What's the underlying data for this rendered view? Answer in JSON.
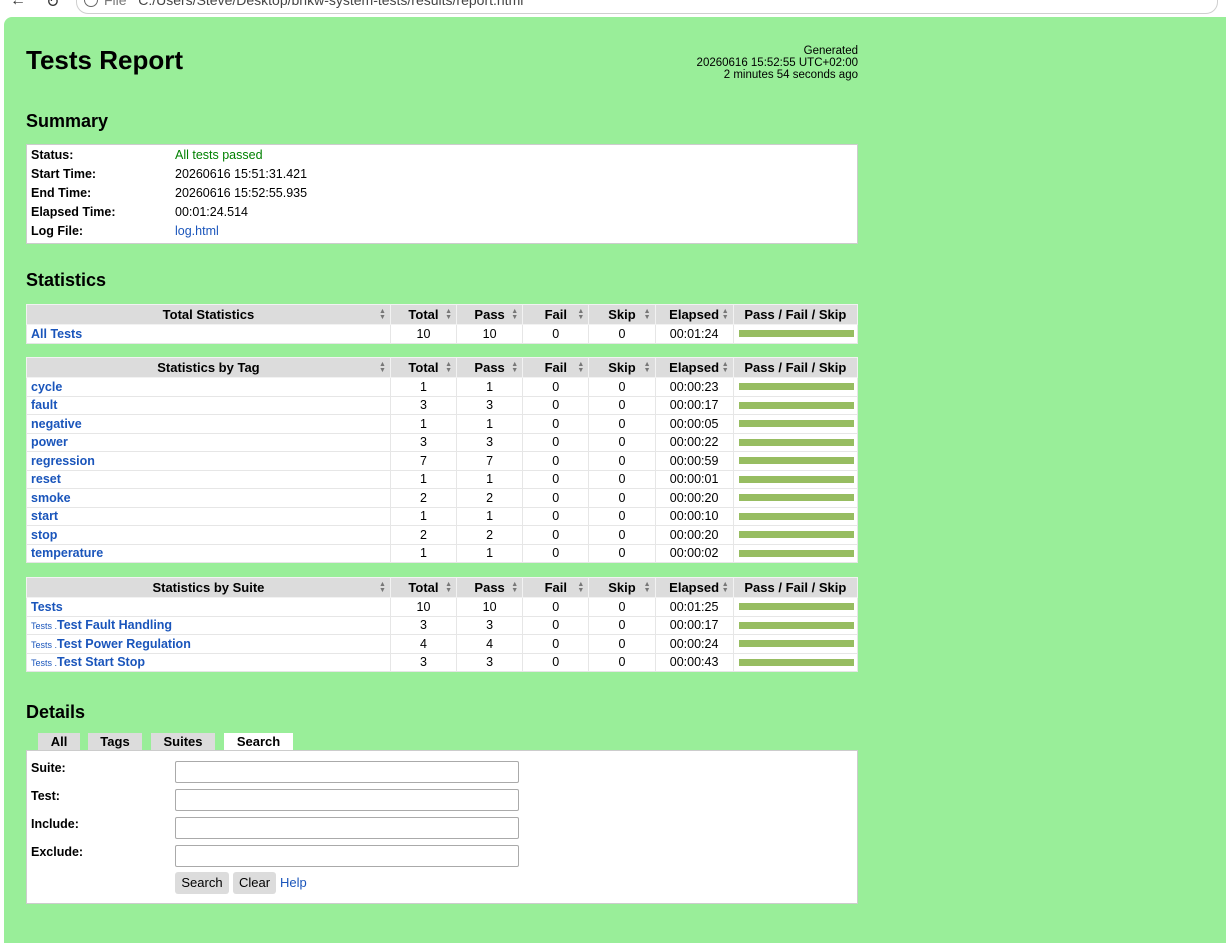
{
  "browser": {
    "url_scheme": "File",
    "url": "C:/Users/Steve/Desktop/bnkw-system-tests/results/report.html"
  },
  "header": {
    "title": "Tests Report",
    "generated_label": "Generated",
    "generated_time": "20260616 15:52:55 UTC+02:00",
    "generated_ago": "2 minutes 54 seconds ago"
  },
  "summary": {
    "heading": "Summary",
    "rows": [
      {
        "key": "Status:",
        "value": "All tests passed"
      },
      {
        "key": "Start Time:",
        "value": "20260616 15:51:31.421"
      },
      {
        "key": "End Time:",
        "value": "20260616 15:52:55.935"
      },
      {
        "key": "Elapsed Time:",
        "value": "00:01:24.514"
      },
      {
        "key": "Log File:",
        "value": "log.html"
      }
    ]
  },
  "statistics": {
    "heading": "Statistics",
    "columns": [
      "Total",
      "Pass",
      "Fail",
      "Skip",
      "Elapsed",
      "Pass / Fail / Skip"
    ],
    "total": {
      "title": "Total Statistics",
      "rows": [
        {
          "name": "All Tests",
          "total": "10",
          "pass": "10",
          "fail": "0",
          "skip": "0",
          "elapsed": "00:01:24",
          "pass_fraction": 1.0
        }
      ]
    },
    "by_tag": {
      "title": "Statistics by Tag",
      "rows": [
        {
          "name": "cycle",
          "total": "1",
          "pass": "1",
          "fail": "0",
          "skip": "0",
          "elapsed": "00:00:23",
          "pass_fraction": 1.0
        },
        {
          "name": "fault",
          "total": "3",
          "pass": "3",
          "fail": "0",
          "skip": "0",
          "elapsed": "00:00:17",
          "pass_fraction": 1.0
        },
        {
          "name": "negative",
          "total": "1",
          "pass": "1",
          "fail": "0",
          "skip": "0",
          "elapsed": "00:00:05",
          "pass_fraction": 1.0
        },
        {
          "name": "power",
          "total": "3",
          "pass": "3",
          "fail": "0",
          "skip": "0",
          "elapsed": "00:00:22",
          "pass_fraction": 1.0
        },
        {
          "name": "regression",
          "total": "7",
          "pass": "7",
          "fail": "0",
          "skip": "0",
          "elapsed": "00:00:59",
          "pass_fraction": 1.0
        },
        {
          "name": "reset",
          "total": "1",
          "pass": "1",
          "fail": "0",
          "skip": "0",
          "elapsed": "00:00:01",
          "pass_fraction": 1.0
        },
        {
          "name": "smoke",
          "total": "2",
          "pass": "2",
          "fail": "0",
          "skip": "0",
          "elapsed": "00:00:20",
          "pass_fraction": 1.0
        },
        {
          "name": "start",
          "total": "1",
          "pass": "1",
          "fail": "0",
          "skip": "0",
          "elapsed": "00:00:10",
          "pass_fraction": 1.0
        },
        {
          "name": "stop",
          "total": "2",
          "pass": "2",
          "fail": "0",
          "skip": "0",
          "elapsed": "00:00:20",
          "pass_fraction": 1.0
        },
        {
          "name": "temperature",
          "total": "1",
          "pass": "1",
          "fail": "0",
          "skip": "0",
          "elapsed": "00:00:02",
          "pass_fraction": 1.0
        }
      ]
    },
    "by_suite": {
      "title": "Statistics by Suite",
      "rows": [
        {
          "prefix": "",
          "name": "Tests",
          "total": "10",
          "pass": "10",
          "fail": "0",
          "skip": "0",
          "elapsed": "00:01:25",
          "pass_fraction": 1.0
        },
        {
          "prefix": "Tests .",
          "name": "Test Fault Handling",
          "total": "3",
          "pass": "3",
          "fail": "0",
          "skip": "0",
          "elapsed": "00:00:17",
          "pass_fraction": 1.0
        },
        {
          "prefix": "Tests .",
          "name": "Test Power Regulation",
          "total": "4",
          "pass": "4",
          "fail": "0",
          "skip": "0",
          "elapsed": "00:00:24",
          "pass_fraction": 1.0
        },
        {
          "prefix": "Tests .",
          "name": "Test Start Stop",
          "total": "3",
          "pass": "3",
          "fail": "0",
          "skip": "0",
          "elapsed": "00:00:43",
          "pass_fraction": 1.0
        }
      ]
    }
  },
  "details": {
    "heading": "Details",
    "tabs": [
      "All",
      "Tags",
      "Suites",
      "Search"
    ],
    "active_tab": "Search",
    "fields": [
      {
        "label": "Suite:",
        "value": ""
      },
      {
        "label": "Test:",
        "value": ""
      },
      {
        "label": "Include:",
        "value": ""
      },
      {
        "label": "Exclude:",
        "value": ""
      }
    ],
    "search_button": "Search",
    "clear_button": "Clear",
    "help_link": "Help"
  },
  "colors": {
    "background": "#99ee99",
    "pass_bar": "#97bd61",
    "link": "#1a55bb",
    "status_pass": "#008000"
  }
}
